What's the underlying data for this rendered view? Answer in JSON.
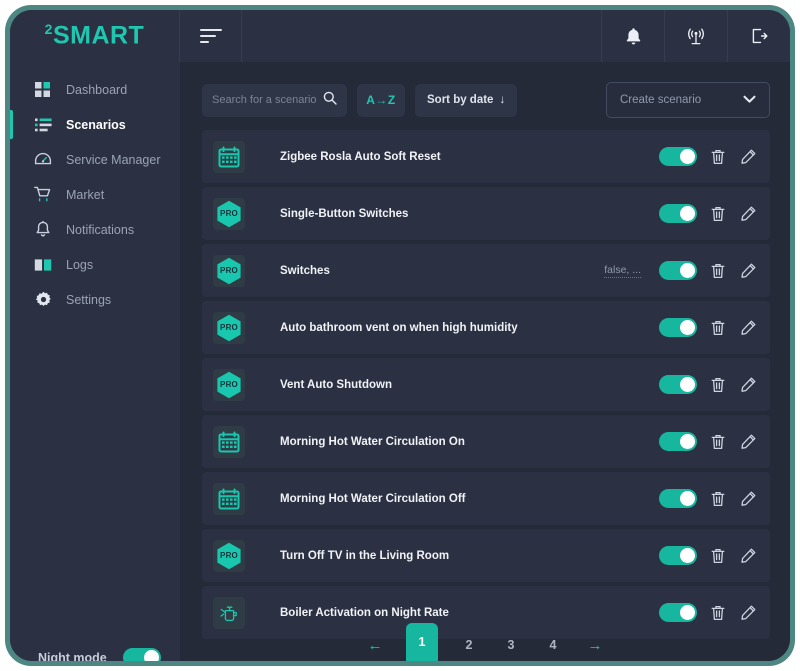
{
  "brand": {
    "sup": "2",
    "name": "SMART"
  },
  "header": {
    "menu_icon": "hamburger-icon",
    "icons": [
      {
        "name": "bell-icon",
        "label": "Notifications"
      },
      {
        "name": "antenna-icon",
        "label": "Broadcast"
      },
      {
        "name": "logout-icon",
        "label": "Log out"
      }
    ]
  },
  "sidebar": {
    "items": [
      {
        "label": "Dashboard",
        "icon": "dashboard-icon",
        "active": false
      },
      {
        "label": "Scenarios",
        "icon": "list-icon",
        "active": true
      },
      {
        "label": "Service Manager",
        "icon": "gauge-icon",
        "active": false
      },
      {
        "label": "Market",
        "icon": "cart-icon",
        "active": false
      },
      {
        "label": "Notifications",
        "icon": "bell-icon",
        "active": false
      },
      {
        "label": "Logs",
        "icon": "book-icon",
        "active": false
      },
      {
        "label": "Settings",
        "icon": "gear-icon",
        "active": false
      }
    ],
    "night_mode": {
      "label": "Night mode",
      "enabled": true
    }
  },
  "toolbar": {
    "search": {
      "placeholder": "Search for a scenario",
      "value": "",
      "icon": "search-icon"
    },
    "sort_alpha": {
      "label": "A→Z"
    },
    "sort_date": {
      "label": "Sort by date",
      "arrow": "↓"
    },
    "create": {
      "label": "Create scenario",
      "icon": "chevron-down-icon"
    }
  },
  "scenarios": [
    {
      "title": "Zigbee Rosla Auto Soft Reset",
      "icon": "calendar-icon",
      "enabled": true,
      "sub": ""
    },
    {
      "title": "Single-Button Switches",
      "icon": "pro-badge-icon",
      "enabled": true,
      "sub": ""
    },
    {
      "title": "Switches",
      "icon": "pro-badge-icon",
      "enabled": true,
      "sub": "false, ..."
    },
    {
      "title": "Auto bathroom vent on when high humidity",
      "icon": "pro-badge-icon",
      "enabled": true,
      "sub": ""
    },
    {
      "title": "Vent  Auto Shutdown",
      "icon": "pro-badge-icon",
      "enabled": true,
      "sub": ""
    },
    {
      "title": "Morning Hot Water Circulation On",
      "icon": "calendar-icon",
      "enabled": true,
      "sub": ""
    },
    {
      "title": "Morning Hot Water Circulation Off",
      "icon": "calendar-icon",
      "enabled": true,
      "sub": ""
    },
    {
      "title": "Turn Off TV in the Living Room",
      "icon": "pro-badge-icon",
      "enabled": true,
      "sub": ""
    },
    {
      "title": "Boiler Activation on Night Rate",
      "icon": "boiler-icon",
      "enabled": true,
      "sub": ""
    }
  ],
  "row_actions": {
    "delete": "trash-icon",
    "edit": "pencil-icon",
    "toggle": "toggle-switch"
  },
  "pagination": {
    "prev": "←",
    "next": "→",
    "pages": [
      "1",
      "2",
      "3",
      "4"
    ],
    "current": "1"
  },
  "colors": {
    "accent": "#1ec8b0",
    "toggle_on": "#17b79f",
    "app_bg": "#242a38",
    "panel_bg": "#2b3142",
    "frame": "#4d8784"
  }
}
